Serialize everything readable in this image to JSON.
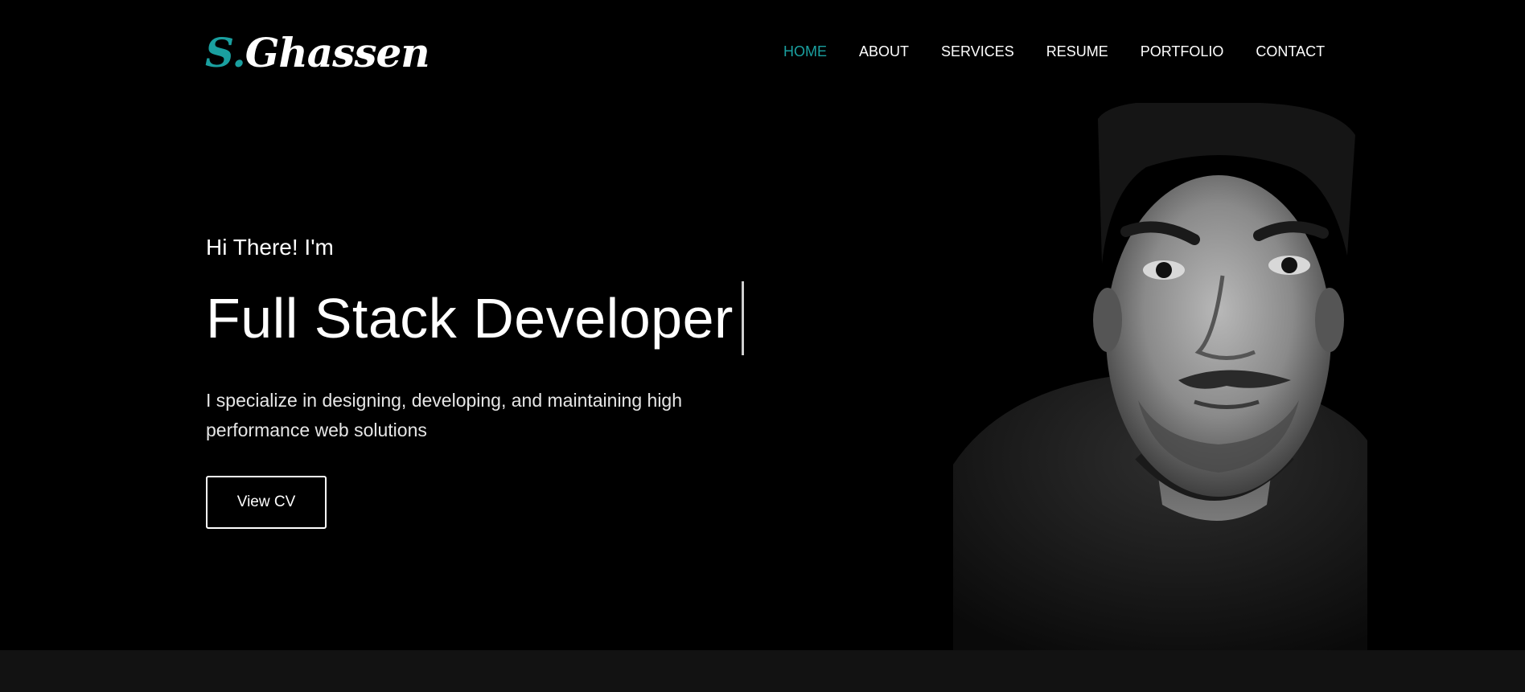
{
  "brand": {
    "initial": "S.",
    "name": "Ghassen",
    "accent_color": "#1aa0a0"
  },
  "nav": {
    "items": [
      {
        "label": "HOME",
        "active": true
      },
      {
        "label": "ABOUT",
        "active": false
      },
      {
        "label": "SERVICES",
        "active": false
      },
      {
        "label": "RESUME",
        "active": false
      },
      {
        "label": "PORTFOLIO",
        "active": false
      },
      {
        "label": "CONTACT",
        "active": false
      }
    ]
  },
  "hero": {
    "greeting": "Hi There! I'm",
    "headline": "Full Stack Developer",
    "description": "I specialize in designing, developing, and maintaining high performance web solutions",
    "cta_label": "View CV"
  },
  "colors": {
    "background": "#000000",
    "text": "#ffffff",
    "footer_strip": "#121212"
  }
}
